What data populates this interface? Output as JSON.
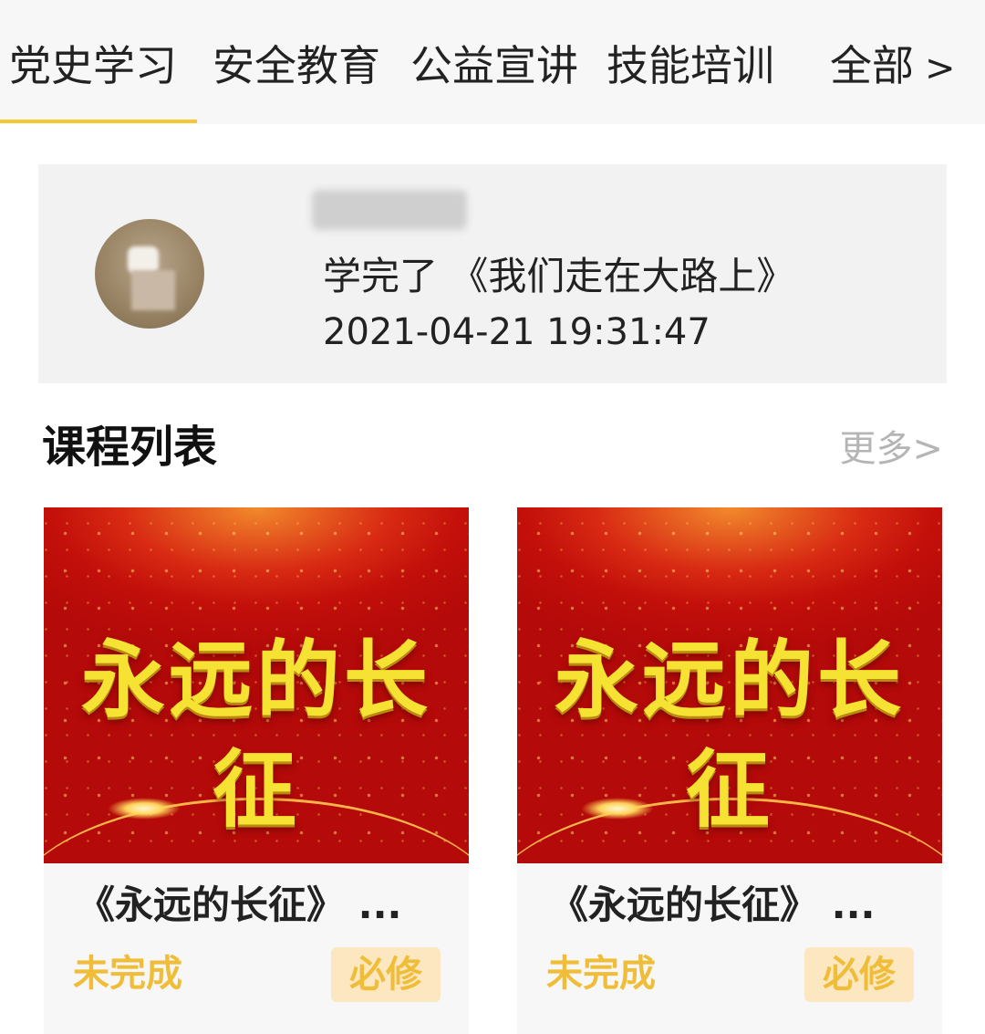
{
  "tabs": {
    "items": [
      {
        "label": "党史学习",
        "active": true
      },
      {
        "label": "安全教育",
        "active": false
      },
      {
        "label": "公益宣讲",
        "active": false
      },
      {
        "label": "技能培训",
        "active": false
      }
    ],
    "all_label": "全部",
    "all_chevron": ">",
    "accent_color": "#f4c734"
  },
  "activity": {
    "username": "",
    "message": "学完了 《我们走在大路上》",
    "timestamp": "2021-04-21 19:31:47"
  },
  "courses_section": {
    "title": "课程列表",
    "more_label": "更多>"
  },
  "courses": [
    {
      "thumbnail_text": "永远的长征",
      "title": "《永远的长征》 ...",
      "status": "未完成",
      "badge": "必修"
    },
    {
      "thumbnail_text": "永远的长征",
      "title": "《永远的长征》 ...",
      "status": "未完成",
      "badge": "必修"
    }
  ],
  "colors": {
    "status_text": "#f0bd38",
    "badge_bg": "#fde7c1",
    "thumbnail_red": "#c20f0a",
    "thumbnail_text": "#f6e233"
  }
}
